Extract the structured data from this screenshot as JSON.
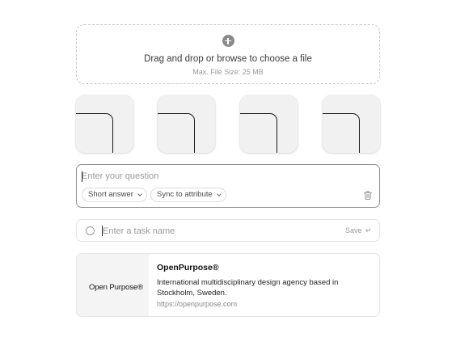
{
  "dropzone": {
    "title": "Drag and drop or browse to choose a file",
    "subtitle": "Max. File Size: 25 MB",
    "icon": "plus-circle-icon"
  },
  "thumbnails": [
    {
      "name": "thumbnail-1"
    },
    {
      "name": "thumbnail-2"
    },
    {
      "name": "thumbnail-3"
    },
    {
      "name": "thumbnail-4"
    }
  ],
  "question": {
    "placeholder": "Enter your question",
    "value": "",
    "type_select": "Short answer",
    "sync_select": "Sync to attribute",
    "delete_icon": "trash-icon"
  },
  "task": {
    "placeholder": "Enter a task name",
    "value": "",
    "save_label": "Save",
    "enter_glyph": "↵"
  },
  "link_card": {
    "logo_text": "Open Purpose®",
    "title": "OpenPurpose®",
    "description": "International multidisciplinary design agency based in Stockholm, Sweden.",
    "url": "https://openpurpose.com"
  },
  "colors": {
    "border_focus": "#8f8f8f",
    "border_light": "#e4e4e4",
    "muted_text": "#9a9a9a",
    "logo_bg": "#f4f4f4"
  }
}
